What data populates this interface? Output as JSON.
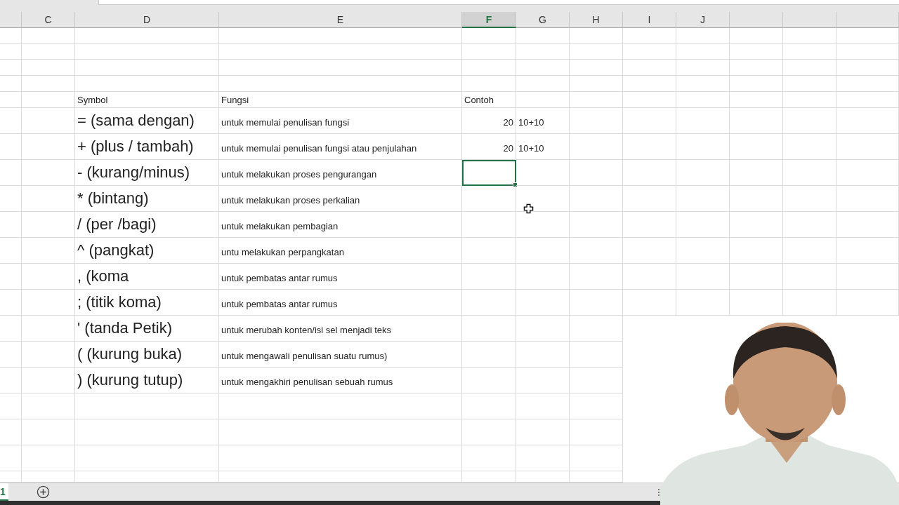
{
  "column_headers": [
    {
      "label": "C",
      "selected": false
    },
    {
      "label": "D",
      "selected": false
    },
    {
      "label": "E",
      "selected": false
    },
    {
      "label": "F",
      "selected": true
    },
    {
      "label": "G",
      "selected": false
    },
    {
      "label": "H",
      "selected": false
    },
    {
      "label": "I",
      "selected": false
    },
    {
      "label": "J",
      "selected": false
    }
  ],
  "table": {
    "header": {
      "symbol": "Symbol",
      "function": "Fungsi",
      "example": "Contoh"
    },
    "rows": [
      {
        "symbol": "= (sama dengan)",
        "function": "untuk memulai penulisan fungsi",
        "result": "20",
        "formula": "10+10",
        "active": false
      },
      {
        "symbol": "+ (plus / tambah)",
        "function": "untuk memulai penulisan fungsi atau penjulahan",
        "result": "20",
        "formula": "10+10",
        "active": false
      },
      {
        "symbol": "- (kurang/minus)",
        "function": "untuk melakukan proses pengurangan",
        "active": true
      },
      {
        "symbol": "* (bintang)",
        "function": "untuk melakukan proses perkalian",
        "active": false
      },
      {
        "symbol": "/ (per /bagi)",
        "function": "untuk melakukan pembagian",
        "active": false
      },
      {
        "symbol": "^ (pangkat)",
        "function": "untu melakukan perpangkatan",
        "active": false
      },
      {
        "symbol": ", (koma",
        "function": "untuk pembatas antar rumus",
        "active": false
      },
      {
        "symbol": "; (titik koma)",
        "function": "untuk pembatas antar rumus",
        "active": false
      },
      {
        "symbol": "' (tanda Petik)",
        "function": "untuk merubah konten/isi sel menjadi teks",
        "active": false
      },
      {
        "symbol": "( (kurung buka)",
        "function": "untuk mengawali penulisan suatu rumus)",
        "active": false
      },
      {
        "symbol": ") (kurung tutup)",
        "function": "untuk mengakhiri penulisan sebuah rumus",
        "active": false
      }
    ]
  },
  "sheet_tabs": [
    {
      "label": "1",
      "selected": true
    }
  ]
}
